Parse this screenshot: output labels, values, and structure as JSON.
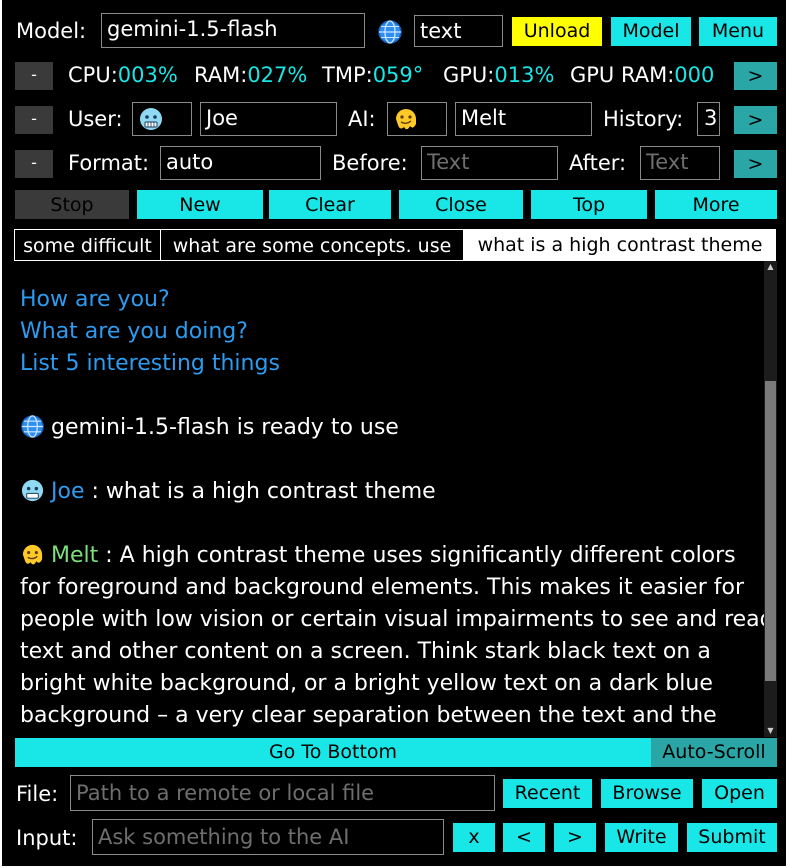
{
  "toolbar": {
    "model_label": "Model:",
    "model_value": "gemini-1.5-flash",
    "mode_value": "text",
    "unload_label": "Unload",
    "model_button_label": "Model",
    "menu_label": "Menu"
  },
  "stats": {
    "collapse_label": "-",
    "cpu_label": "CPU:",
    "cpu_value": "003%",
    "ram_label": "RAM:",
    "ram_value": "027%",
    "tmp_label": "TMP:",
    "tmp_value": "059°",
    "gpu_label": "GPU:",
    "gpu_value": "013%",
    "gpu_ram_label": "GPU RAM:",
    "gpu_ram_value": "000",
    "expand_label": ">"
  },
  "persona": {
    "collapse_label": "-",
    "user_label": "User:",
    "user_name": "Joe",
    "ai_label": "AI:",
    "ai_name": "Melt",
    "history_label": "History:",
    "history_value": "3",
    "expand_label": ">"
  },
  "format": {
    "collapse_label": "-",
    "format_label": "Format:",
    "format_value": "auto",
    "before_label": "Before:",
    "before_placeholder": "Text",
    "after_label": "After:",
    "after_placeholder": "Text",
    "expand_label": ">"
  },
  "actions": {
    "stop": "Stop",
    "new": "New",
    "clear": "Clear",
    "close": "Close",
    "top": "Top",
    "more": "More"
  },
  "tabs": [
    {
      "label": "some difficult"
    },
    {
      "label": "what are some concepts. use"
    },
    {
      "label": "what is a high contrast theme"
    }
  ],
  "chat": {
    "suggestions": [
      "How are you?",
      "What are you doing?",
      "List 5 interesting things"
    ],
    "system_message": "gemini-1.5-flash is ready to use",
    "user_name": "Joe",
    "user_message": " : what is a high contrast theme",
    "ai_name": "Melt",
    "ai_first_line": " : A high contrast theme uses significantly different colors",
    "ai_lines": [
      "for foreground and background elements.  This makes it easier for",
      "people with low vision or certain visual impairments to see and read",
      "text and other content on a screen.  Think stark black text on a",
      "bright white background, or a bright yellow text on a dark blue",
      "background – a very clear separation between the text and the"
    ]
  },
  "bottom_bar": {
    "go_to_bottom": "Go To Bottom",
    "auto_scroll": "Auto-Scroll"
  },
  "file_row": {
    "label": "File:",
    "placeholder": "Path to a remote or local file",
    "recent": "Recent",
    "browse": "Browse",
    "open": "Open"
  },
  "input_row": {
    "label": "Input:",
    "placeholder": "Ask something to the AI",
    "clear": "x",
    "prev": "<",
    "next": ">",
    "write": "Write",
    "submit": "Submit"
  },
  "icons": {
    "globe": "globe-icon",
    "user_avatar": "cold-face-icon",
    "ai_avatar": "melting-face-icon"
  },
  "colors": {
    "accent": "#19e6e6",
    "unload": "#ffff00",
    "question": "#2e9bf0",
    "ai_name": "#7be07b"
  }
}
